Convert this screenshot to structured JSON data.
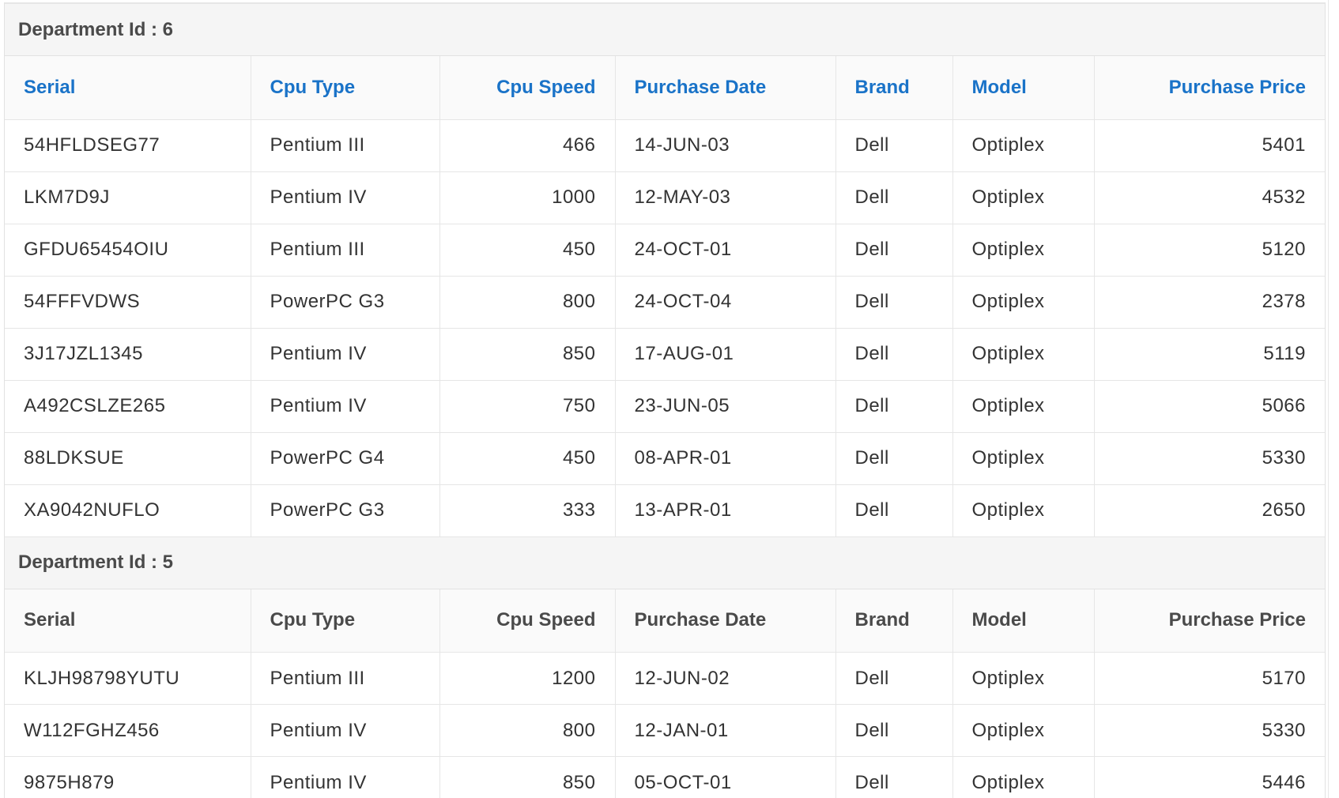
{
  "columns": {
    "serial": "Serial",
    "cpu_type": "Cpu Type",
    "cpu_speed": "Cpu Speed",
    "purchase_date": "Purchase Date",
    "brand": "Brand",
    "model": "Model",
    "purchase_price": "Purchase Price"
  },
  "groups": [
    {
      "label": "Department Id : 6",
      "rows": [
        {
          "serial": "54HFLDSEG77",
          "cpu_type": "Pentium III",
          "cpu_speed": "466",
          "purchase_date": "14-JUN-03",
          "brand": "Dell",
          "model": "Optiplex",
          "purchase_price": "5401"
        },
        {
          "serial": "LKM7D9J",
          "cpu_type": "Pentium IV",
          "cpu_speed": "1000",
          "purchase_date": "12-MAY-03",
          "brand": "Dell",
          "model": "Optiplex",
          "purchase_price": "4532"
        },
        {
          "serial": "GFDU65454OIU",
          "cpu_type": "Pentium III",
          "cpu_speed": "450",
          "purchase_date": "24-OCT-01",
          "brand": "Dell",
          "model": "Optiplex",
          "purchase_price": "5120"
        },
        {
          "serial": "54FFFVDWS",
          "cpu_type": "PowerPC G3",
          "cpu_speed": "800",
          "purchase_date": "24-OCT-04",
          "brand": "Dell",
          "model": "Optiplex",
          "purchase_price": "2378"
        },
        {
          "serial": "3J17JZL1345",
          "cpu_type": "Pentium IV",
          "cpu_speed": "850",
          "purchase_date": "17-AUG-01",
          "brand": "Dell",
          "model": "Optiplex",
          "purchase_price": "5119"
        },
        {
          "serial": "A492CSLZE265",
          "cpu_type": "Pentium IV",
          "cpu_speed": "750",
          "purchase_date": "23-JUN-05",
          "brand": "Dell",
          "model": "Optiplex",
          "purchase_price": "5066"
        },
        {
          "serial": "88LDKSUE",
          "cpu_type": "PowerPC G4",
          "cpu_speed": "450",
          "purchase_date": "08-APR-01",
          "brand": "Dell",
          "model": "Optiplex",
          "purchase_price": "5330"
        },
        {
          "serial": "XA9042NUFLO",
          "cpu_type": "PowerPC G3",
          "cpu_speed": "333",
          "purchase_date": "13-APR-01",
          "brand": "Dell",
          "model": "Optiplex",
          "purchase_price": "2650"
        }
      ]
    },
    {
      "label": "Department Id : 5",
      "rows": [
        {
          "serial": "KLJH98798YUTU",
          "cpu_type": "Pentium III",
          "cpu_speed": "1200",
          "purchase_date": "12-JUN-02",
          "brand": "Dell",
          "model": "Optiplex",
          "purchase_price": "5170"
        },
        {
          "serial": "W112FGHZ456",
          "cpu_type": "Pentium IV",
          "cpu_speed": "800",
          "purchase_date": "12-JAN-01",
          "brand": "Dell",
          "model": "Optiplex",
          "purchase_price": "5330"
        },
        {
          "serial": "9875H879",
          "cpu_type": "Pentium IV",
          "cpu_speed": "850",
          "purchase_date": "05-OCT-01",
          "brand": "Dell",
          "model": "Optiplex",
          "purchase_price": "5446"
        }
      ]
    }
  ]
}
